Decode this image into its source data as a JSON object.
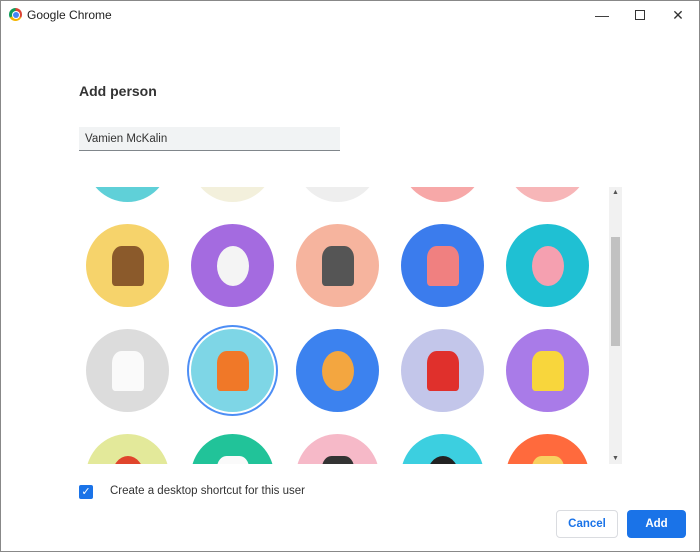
{
  "window": {
    "title": "Google Chrome",
    "minimize_icon": "minimize-icon",
    "maximize_icon": "maximize-icon",
    "close_icon": "close-icon"
  },
  "dialog": {
    "heading": "Add person",
    "name_value": "Vamien McKalin",
    "avatars": [
      {
        "name": "avatar-partial-1",
        "bg": "#5fd0d8",
        "fig": "#3aa"
      },
      {
        "name": "avatar-partial-2",
        "bg": "#f3f0dc",
        "fig": "#ddd"
      },
      {
        "name": "avatar-partial-3",
        "bg": "#eeeeee",
        "fig": "#ccc"
      },
      {
        "name": "avatar-partial-4",
        "bg": "#f7a8a8",
        "fig": "#e77"
      },
      {
        "name": "avatar-partial-5",
        "bg": "#f7b6b8",
        "fig": "#e88"
      },
      {
        "name": "avatar-monkey",
        "bg": "#f6d36b",
        "fig": "#8b5a2b"
      },
      {
        "name": "avatar-panda",
        "bg": "#a46be0",
        "fig": "#f4f4f4"
      },
      {
        "name": "avatar-penguin",
        "bg": "#f6b49e",
        "fig": "#555"
      },
      {
        "name": "avatar-butterfly",
        "bg": "#3b7ced",
        "fig": "#f08080"
      },
      {
        "name": "avatar-rabbit",
        "bg": "#1fc0d3",
        "fig": "#f5a0b0"
      },
      {
        "name": "avatar-unicorn",
        "bg": "#dcdcdc",
        "fig": "#fafafa"
      },
      {
        "name": "avatar-basketball",
        "bg": "#7ed6e6",
        "fig": "#f07828",
        "selected": true
      },
      {
        "name": "avatar-bicycle",
        "bg": "#3c82ef",
        "fig": "#f3a640"
      },
      {
        "name": "avatar-bird",
        "bg": "#c3c6ea",
        "fig": "#e0302c"
      },
      {
        "name": "avatar-cheese",
        "bg": "#a97be8",
        "fig": "#f8d63c"
      },
      {
        "name": "avatar-football",
        "bg": "#e3e99a",
        "fig": "#e0452c"
      },
      {
        "name": "avatar-noodles",
        "bg": "#21c399",
        "fig": "#fafafa"
      },
      {
        "name": "avatar-sunglasses",
        "bg": "#f6b9c8",
        "fig": "#333"
      },
      {
        "name": "avatar-sushi",
        "bg": "#3ccfe0",
        "fig": "#222"
      },
      {
        "name": "avatar-food",
        "bg": "#ff6a3d",
        "fig": "#f8d060"
      }
    ],
    "shortcut_checked": true,
    "shortcut_label": "Create a desktop shortcut for this user",
    "cancel_label": "Cancel",
    "add_label": "Add",
    "accent": "#1a73e8"
  }
}
